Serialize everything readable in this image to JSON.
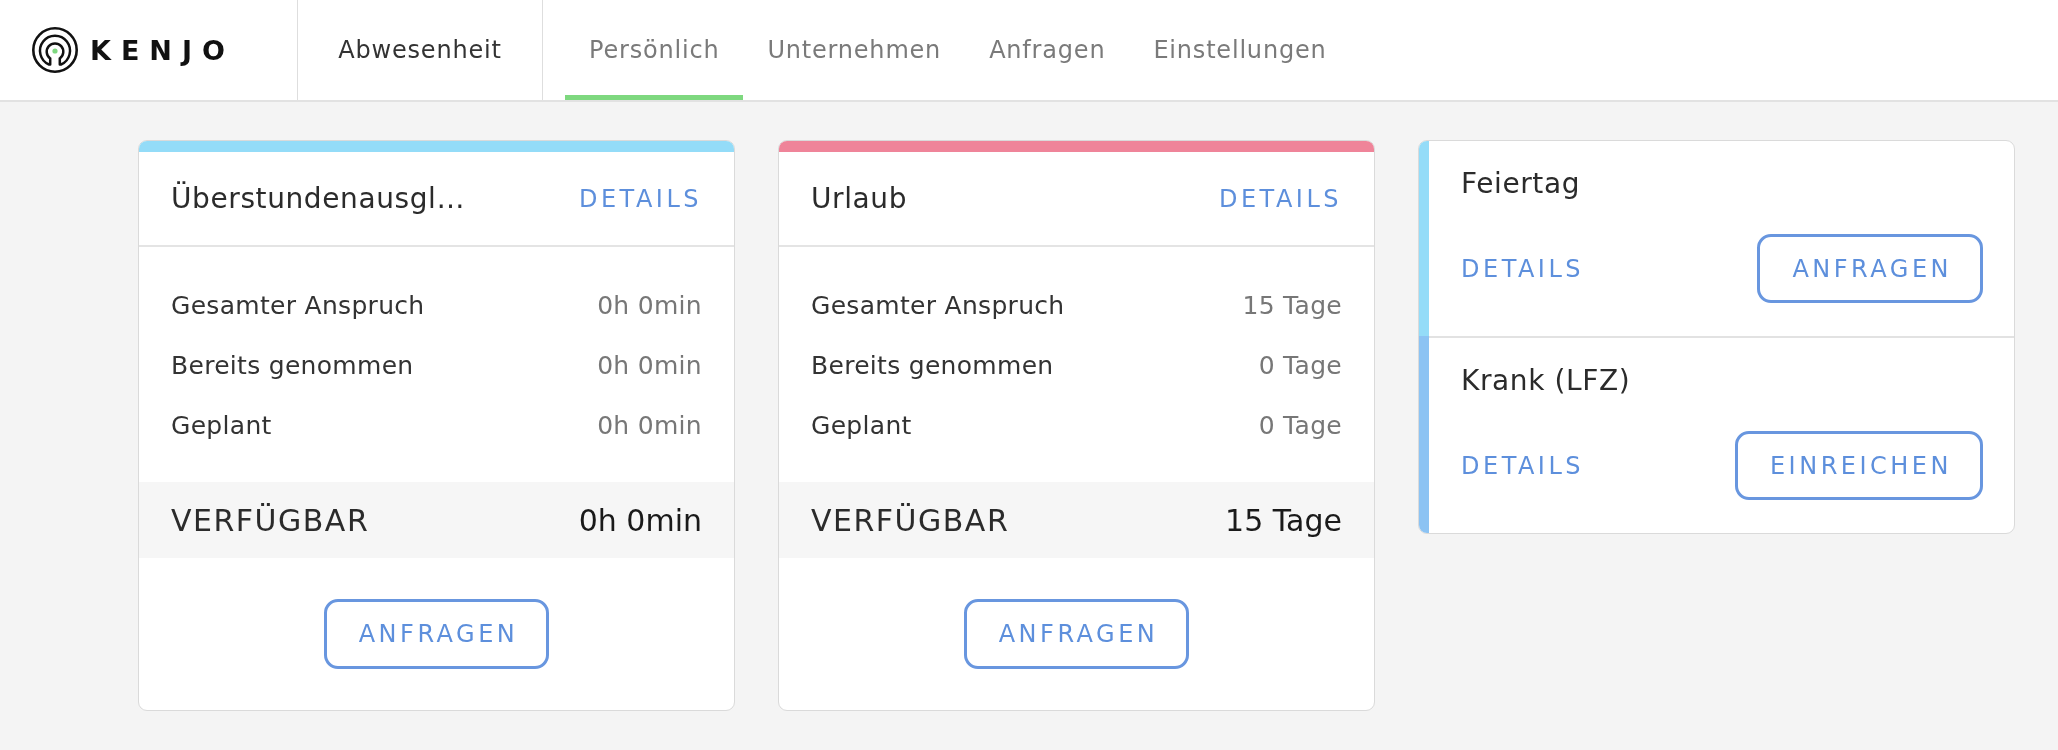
{
  "header": {
    "logo_text": "KENJO",
    "section": "Abwesenheit",
    "tabs": [
      {
        "label": "Persönlich",
        "selected": true
      },
      {
        "label": "Unternehmen",
        "selected": false
      },
      {
        "label": "Anfragen",
        "selected": false
      },
      {
        "label": "Einstellungen",
        "selected": false
      }
    ]
  },
  "balance_cards": [
    {
      "title": "Überstundenausgl…",
      "color": "#94dcf8",
      "details": "DETAILS",
      "rows": [
        {
          "label": "Gesamter Anspruch",
          "value": "0h 0min"
        },
        {
          "label": "Bereits genommen",
          "value": "0h 0min"
        },
        {
          "label": "Geplant",
          "value": "0h 0min"
        }
      ],
      "available": {
        "label": "VERFÜGBAR",
        "value": "0h 0min"
      },
      "action": "ANFRAGEN"
    },
    {
      "title": "Urlaub",
      "color": "#ef8499",
      "details": "DETAILS",
      "rows": [
        {
          "label": "Gesamter Anspruch",
          "value": "15 Tage"
        },
        {
          "label": "Bereits genommen",
          "value": "0 Tage"
        },
        {
          "label": "Geplant",
          "value": "0 Tage"
        }
      ],
      "available": {
        "label": "VERFÜGBAR",
        "value": "15 Tage"
      },
      "action": "ANFRAGEN"
    }
  ],
  "absence_types": [
    {
      "title": "Feiertag",
      "color": "#94dcf8",
      "details": "DETAILS",
      "action": "ANFRAGEN"
    },
    {
      "title": "Krank (LFZ)",
      "color": "#8cc3f3",
      "details": "DETAILS",
      "action": "EINREICHEN"
    }
  ]
}
